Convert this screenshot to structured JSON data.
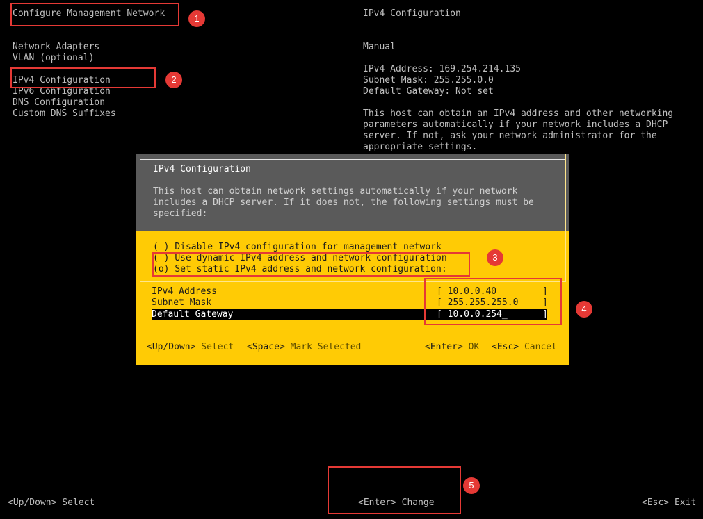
{
  "header": {
    "left_title": "Configure Management Network",
    "right_title": "IPv4 Configuration"
  },
  "menu": {
    "items": [
      {
        "label": "Network Adapters"
      },
      {
        "label": "VLAN (optional)"
      },
      {
        "label": "IPv4 Configuration"
      },
      {
        "label": "IPv6 Configuration"
      },
      {
        "label": "DNS Configuration"
      },
      {
        "label": "Custom DNS Suffixes"
      }
    ]
  },
  "info": {
    "mode": "Manual",
    "ipv4_address": "IPv4 Address: 169.254.214.135",
    "subnet_mask": "Subnet Mask: 255.255.0.0",
    "default_gateway": "Default Gateway: Not set",
    "description_lines": [
      "This host can obtain an IPv4 address and other networking",
      "parameters automatically if your network includes a DHCP",
      "server. If not, ask your network administrator for the",
      "appropriate settings."
    ]
  },
  "dialog": {
    "title": "IPv4 Configuration",
    "description_lines": [
      "This host can obtain network settings automatically if your network",
      "includes a DHCP server. If it does not, the following settings must be",
      "specified:"
    ],
    "options": [
      {
        "marker": "( )",
        "label": "Disable IPv4 configuration for management network"
      },
      {
        "marker": "( )",
        "label": "Use dynamic IPv4 address and network configuration"
      },
      {
        "marker": "(o)",
        "label": "Set static IPv4 address and network configuration:"
      }
    ],
    "fields": [
      {
        "label": "IPv4 Address",
        "value": "10.0.0.40"
      },
      {
        "label": "Subnet Mask",
        "value": "255.255.255.0"
      },
      {
        "label": "Default Gateway",
        "value": "10.0.0.254_"
      }
    ],
    "hints": {
      "updown_key": "<Up/Down>",
      "updown_action": "Select",
      "space_key": "<Space>",
      "space_action": "Mark Selected",
      "enter_key": "<Enter>",
      "enter_action": "OK",
      "esc_key": "<Esc>",
      "esc_action": "Cancel"
    }
  },
  "footer": {
    "updown": "<Up/Down> Select",
    "enter": "<Enter> Change",
    "esc": "<Esc> Exit"
  },
  "annotations": [
    "1",
    "2",
    "3",
    "4",
    "5"
  ],
  "colors": {
    "dialog_body": "#ffcb05",
    "dialog_head": "#5a5a5a",
    "annotation": "#e53935",
    "background": "#000000"
  }
}
